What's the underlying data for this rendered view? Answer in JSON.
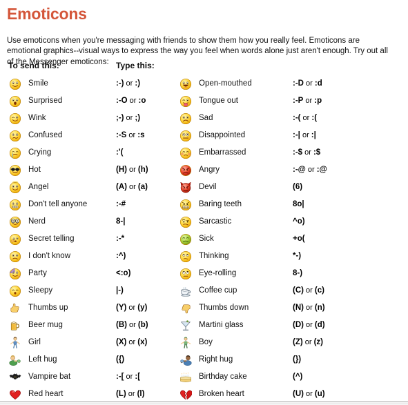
{
  "page": {
    "title": "Emoticons",
    "title_color": "#d4563a",
    "intro": "Use emoticons when you're messaging with friends to show them how you really feel. Emoticons are emotional graphics--visual ways to express the way you feel when words alone just aren't enough. Try out all of the Messenger emoticons:"
  },
  "headers": {
    "send": "To send this:",
    "type": "Type this:"
  },
  "left_column": [
    {
      "icon": "smile-emoticon",
      "label": "Smile",
      "code": ":-) or :)"
    },
    {
      "icon": "surprised-emoticon",
      "label": "Surprised",
      "code": ":-O or :o"
    },
    {
      "icon": "wink-emoticon",
      "label": "Wink",
      "code": ";-) or ;)"
    },
    {
      "icon": "confused-emoticon",
      "label": "Confused",
      "code": ":-S or :s"
    },
    {
      "icon": "crying-emoticon",
      "label": "Crying",
      "code": ":'("
    },
    {
      "icon": "hot-emoticon",
      "label": "Hot",
      "code": "(H) or (h)"
    },
    {
      "icon": "angel-emoticon",
      "label": "Angel",
      "code": "(A) or (a)"
    },
    {
      "icon": "dont-tell-anyone-emoticon",
      "label": "Don't tell anyone",
      "code": ":-#"
    },
    {
      "icon": "nerd-emoticon",
      "label": "Nerd",
      "code": "8-|"
    },
    {
      "icon": "secret-telling-emoticon",
      "label": "Secret telling",
      "code": ":-*"
    },
    {
      "icon": "i-dont-know-emoticon",
      "label": "I don't know",
      "code": ":^)"
    },
    {
      "icon": "party-emoticon",
      "label": "Party",
      "code": "<:o)"
    },
    {
      "icon": "sleepy-emoticon",
      "label": "Sleepy",
      "code": "|-)"
    },
    {
      "icon": "thumbs-up-emoticon",
      "label": "Thumbs up",
      "code": "(Y) or (y)"
    },
    {
      "icon": "beer-mug-emoticon",
      "label": "Beer mug",
      "code": "(B) or (b)"
    },
    {
      "icon": "girl-emoticon",
      "label": "Girl",
      "code": "(X) or (x)"
    },
    {
      "icon": "left-hug-emoticon",
      "label": "Left hug",
      "code": "({)"
    },
    {
      "icon": "vampire-bat-emoticon",
      "label": "Vampire bat",
      "code": ":-[ or :["
    },
    {
      "icon": "red-heart-emoticon",
      "label": "Red heart",
      "code": "(L) or (l)"
    }
  ],
  "right_column": [
    {
      "icon": "open-mouthed-emoticon",
      "label": "Open-mouthed",
      "code": ":-D or :d"
    },
    {
      "icon": "tongue-out-emoticon",
      "label": "Tongue out",
      "code": ":-P or :p"
    },
    {
      "icon": "sad-emoticon",
      "label": "Sad",
      "code": ":-( or :("
    },
    {
      "icon": "disappointed-emoticon",
      "label": "Disappointed",
      "code": ":-| or :|"
    },
    {
      "icon": "embarrassed-emoticon",
      "label": "Embarrassed",
      "code": ":-$ or :$"
    },
    {
      "icon": "angry-emoticon",
      "label": "Angry",
      "code": ":-@ or :@"
    },
    {
      "icon": "devil-emoticon",
      "label": "Devil",
      "code": "(6)"
    },
    {
      "icon": "baring-teeth-emoticon",
      "label": "Baring teeth",
      "code": "8o|"
    },
    {
      "icon": "sarcastic-emoticon",
      "label": "Sarcastic",
      "code": "^o)"
    },
    {
      "icon": "sick-emoticon",
      "label": "Sick",
      "code": "+o("
    },
    {
      "icon": "thinking-emoticon",
      "label": "Thinking",
      "code": "*-)"
    },
    {
      "icon": "eye-rolling-emoticon",
      "label": "Eye-rolling",
      "code": "8-)"
    },
    {
      "icon": "coffee-cup-emoticon",
      "label": "Coffee cup",
      "code": "(C) or (c)"
    },
    {
      "icon": "thumbs-down-emoticon",
      "label": "Thumbs down",
      "code": "(N) or (n)"
    },
    {
      "icon": "martini-glass-emoticon",
      "label": "Martini glass",
      "code": "(D) or (d)"
    },
    {
      "icon": "boy-emoticon",
      "label": "Boy",
      "code": "(Z) or (z)"
    },
    {
      "icon": "right-hug-emoticon",
      "label": "Right hug",
      "code": "(})"
    },
    {
      "icon": "birthday-cake-emoticon",
      "label": "Birthday cake",
      "code": "(^)"
    },
    {
      "icon": "broken-heart-emoticon",
      "label": "Broken heart",
      "code": "(U) or (u)"
    }
  ]
}
